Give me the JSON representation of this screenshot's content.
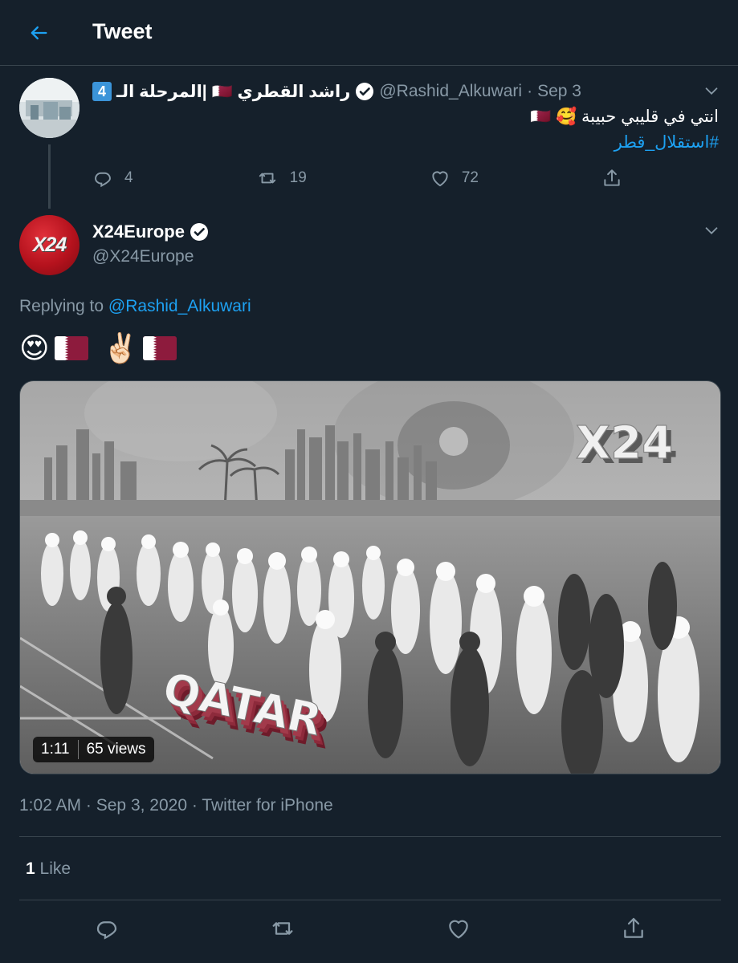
{
  "header": {
    "title": "Tweet"
  },
  "parent_tweet": {
    "badge": "4",
    "name": "راشد القطري 🇶🇦 |المرحلة الـ",
    "handle": "@Rashid_Alkuwari",
    "separator": "·",
    "date": "Sep 3",
    "text": "انتي في قليبي حبيبة 🥰 🇶🇦",
    "hashtag": "#استقلال_قطر",
    "reply_count": "4",
    "retweet_count": "19",
    "like_count": "72"
  },
  "main_tweet": {
    "avatar_text": "X24",
    "name": "X24Europe",
    "handle": "@X24Europe",
    "replying_prefix": "Replying to",
    "replying_to": "@Rashid_Alkuwari",
    "emojis": [
      "😍",
      "✌🏻"
    ],
    "video": {
      "duration": "1:11",
      "views": "65 views",
      "overlay_text": "QATAR",
      "logo_text": "X24"
    },
    "timestamp": "1:02 AM",
    "date": "Sep 3, 2020",
    "source": "Twitter for iPhone",
    "separator": "·",
    "like_count": "1",
    "like_label": "Like"
  },
  "icons": {
    "back": "back-arrow-icon",
    "verified": "verified-badge-icon",
    "caret": "chevron-down-icon",
    "reply": "reply-icon",
    "retweet": "retweet-icon",
    "like": "heart-icon",
    "share": "share-icon"
  },
  "colors": {
    "background": "#15202b",
    "accent": "#1da1f2",
    "muted": "#8899a6",
    "border": "#38444d",
    "qatar_maroon": "#8d1b3d"
  }
}
